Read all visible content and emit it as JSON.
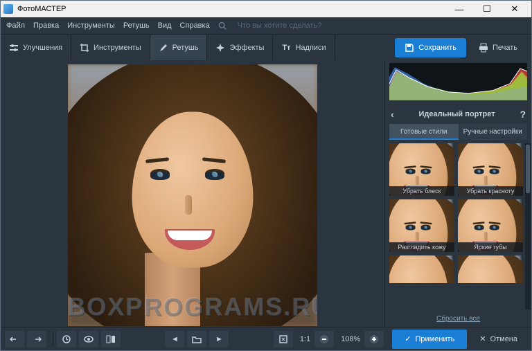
{
  "title": "ФотоМАСТЕР",
  "menu": {
    "file": "Файл",
    "edit": "Правка",
    "instruments": "Инструменты",
    "retouch": "Ретушь",
    "view": "Вид",
    "help": "Справка",
    "search_placeholder": "Что вы хотите сделать?"
  },
  "tabs": {
    "enhance": "Улучшения",
    "instruments": "Инструменты",
    "retouch": "Ретушь",
    "effects": "Эффекты",
    "text": "Надписи"
  },
  "actions": {
    "save": "Сохранить",
    "print": "Печать"
  },
  "panel": {
    "title": "Идеальный портрет",
    "tab_ready": "Готовые стили",
    "tab_manual": "Ручные настройки",
    "reset": "Сбросить все"
  },
  "presets": [
    {
      "label": "Убрать блеск"
    },
    {
      "label": "Убрать красноту"
    },
    {
      "label": "Разгладить кожу"
    },
    {
      "label": "Яркие губы"
    }
  ],
  "footer": {
    "ratio": "1:1",
    "zoom": "108%",
    "apply": "Применить",
    "cancel": "Отмена"
  },
  "watermark": "BOXPROGRAMS.RU"
}
